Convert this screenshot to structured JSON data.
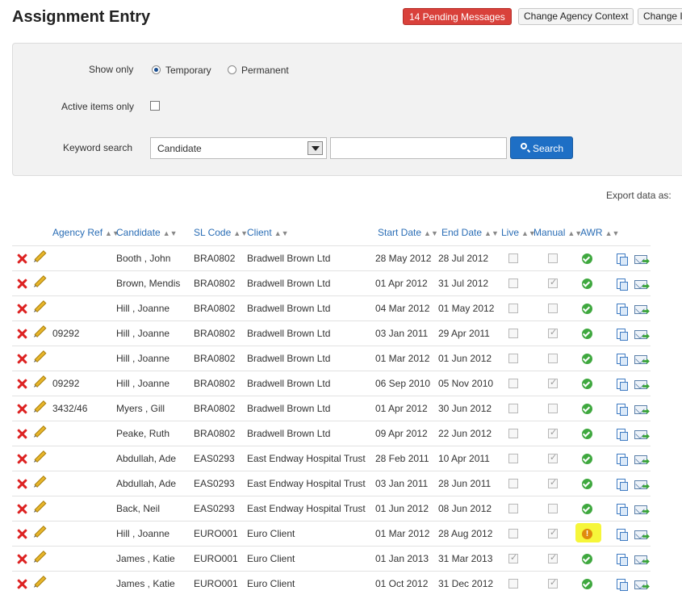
{
  "header": {
    "title": "Assignment Entry",
    "pending_messages": "14 Pending Messages",
    "change_agency_context": "Change Agency Context",
    "change_partial": "Change I"
  },
  "filters": {
    "show_only_label": "Show only",
    "option_temporary": "Temporary",
    "option_permanent": "Permanent",
    "selected_option": "Temporary",
    "active_items_label": "Active items only",
    "active_items_checked": false,
    "keyword_label": "Keyword search",
    "keyword_field_selected": "Candidate",
    "keyword_value": "",
    "search_button": "Search"
  },
  "export_label": "Export data as:",
  "table": {
    "columns": [
      "Agency Ref",
      "Candidate",
      "SL Code",
      "Client",
      "Start Date",
      "End Date",
      "Live",
      "Manual",
      "AWR"
    ],
    "rows": [
      {
        "agency_ref": "",
        "candidate": "Booth , John",
        "sl_code": "BRA0802",
        "client": "Bradwell Brown Ltd",
        "start": "28 May 2012",
        "end": "28 Jul 2012",
        "live": false,
        "manual": false,
        "awr": "ok"
      },
      {
        "agency_ref": "",
        "candidate": "Brown, Mendis",
        "sl_code": "BRA0802",
        "client": "Bradwell Brown Ltd",
        "start": "01 Apr 2012",
        "end": "31 Jul 2012",
        "live": false,
        "manual": true,
        "awr": "ok"
      },
      {
        "agency_ref": "",
        "candidate": "Hill , Joanne",
        "sl_code": "BRA0802",
        "client": "Bradwell Brown Ltd",
        "start": "04 Mar 2012",
        "end": "01 May 2012",
        "live": false,
        "manual": false,
        "awr": "ok"
      },
      {
        "agency_ref": "09292",
        "candidate": "Hill , Joanne",
        "sl_code": "BRA0802",
        "client": "Bradwell Brown Ltd",
        "start": "03 Jan 2011",
        "end": "29 Apr 2011",
        "live": false,
        "manual": true,
        "awr": "ok"
      },
      {
        "agency_ref": "",
        "candidate": "Hill , Joanne",
        "sl_code": "BRA0802",
        "client": "Bradwell Brown Ltd",
        "start": "01 Mar 2012",
        "end": "01 Jun 2012",
        "live": false,
        "manual": false,
        "awr": "ok"
      },
      {
        "agency_ref": "09292",
        "candidate": "Hill , Joanne",
        "sl_code": "BRA0802",
        "client": "Bradwell Brown Ltd",
        "start": "06 Sep 2010",
        "end": "05 Nov 2010",
        "live": false,
        "manual": true,
        "awr": "ok"
      },
      {
        "agency_ref": "3432/46",
        "candidate": "Myers , Gill",
        "sl_code": "BRA0802",
        "client": "Bradwell Brown Ltd",
        "start": "01 Apr 2012",
        "end": "30 Jun 2012",
        "live": false,
        "manual": false,
        "awr": "ok"
      },
      {
        "agency_ref": "",
        "candidate": "Peake, Ruth",
        "sl_code": "BRA0802",
        "client": "Bradwell Brown Ltd",
        "start": "09 Apr 2012",
        "end": "22 Jun 2012",
        "live": false,
        "manual": true,
        "awr": "ok"
      },
      {
        "agency_ref": "",
        "candidate": "Abdullah, Ade",
        "sl_code": "EAS0293",
        "client": "East Endway Hospital Trust",
        "start": "28 Feb 2011",
        "end": "10 Apr 2011",
        "live": false,
        "manual": true,
        "awr": "ok"
      },
      {
        "agency_ref": "",
        "candidate": "Abdullah, Ade",
        "sl_code": "EAS0293",
        "client": "East Endway Hospital Trust",
        "start": "03 Jan 2011",
        "end": "28 Jun 2011",
        "live": false,
        "manual": true,
        "awr": "ok"
      },
      {
        "agency_ref": "",
        "candidate": "Back, Neil",
        "sl_code": "EAS0293",
        "client": "East Endway Hospital Trust",
        "start": "01 Jun 2012",
        "end": "08 Jun 2012",
        "live": false,
        "manual": false,
        "awr": "ok"
      },
      {
        "agency_ref": "",
        "candidate": "Hill , Joanne",
        "sl_code": "EURO001",
        "client": "Euro Client",
        "start": "01 Mar 2012",
        "end": "28 Aug 2012",
        "live": false,
        "manual": true,
        "awr": "warn"
      },
      {
        "agency_ref": "",
        "candidate": "James , Katie",
        "sl_code": "EURO001",
        "client": "Euro Client",
        "start": "01 Jan 2013",
        "end": "31 Mar 2013",
        "live": true,
        "manual": true,
        "awr": "ok"
      },
      {
        "agency_ref": "",
        "candidate": "James , Katie",
        "sl_code": "EURO001",
        "client": "Euro Client",
        "start": "01 Oct 2012",
        "end": "31 Dec 2012",
        "live": false,
        "manual": true,
        "awr": "ok"
      }
    ]
  }
}
